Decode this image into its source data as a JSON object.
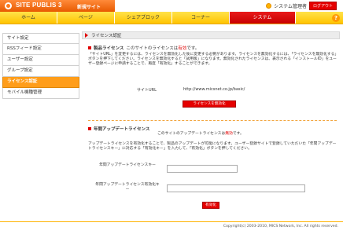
{
  "header": {
    "logo_text": "SITE PUBLIS 3",
    "site_name": "新規サイト",
    "user_label": "システム管理者",
    "logout_label": "ログアウト"
  },
  "nav": {
    "tabs": [
      {
        "label": "ホーム"
      },
      {
        "label": "ページ"
      },
      {
        "label": "シェアブロック"
      },
      {
        "label": "コーナー"
      },
      {
        "label": "システム"
      }
    ],
    "help_label": "?"
  },
  "sidebar": {
    "items": [
      {
        "label": "サイト設定"
      },
      {
        "label": "RSSフィード設定"
      },
      {
        "label": "ユーザー設定"
      },
      {
        "label": "グループ設定"
      },
      {
        "label": "ライセンス認証"
      },
      {
        "label": "モバイル機種管理"
      }
    ]
  },
  "main": {
    "title": "ライセンス認証",
    "product": {
      "heading": "製品ライセンス",
      "status_prefix": "このサイトのライセンスは",
      "status_value": "有効",
      "status_suffix": "です。",
      "description": "「サイトURL」を変更するには、ライセンスを無効化した後に変更する必要があります。ライセンスを無効化するには、「ライセンスを無効化する」ボタンを押下してください。ライセンスを無効化すると「試用版」になります。無効化されたライセンスは、表示される「インストールID」をユーザー登録ページに申請することで、再度「有効化」することができます。",
      "url_label": "サイトURL",
      "url_value": "http://www.micsnet.co.jp/basic/",
      "deactivate_label": "ライセンスを無効化"
    },
    "update": {
      "heading": "年間アップデートライセンス",
      "status_prefix": "このサイトのアップデートライセンスは",
      "status_value": "無効",
      "status_suffix": "です。",
      "description": "アップデートライセンスを有効化することで、製品のアップデートが可能になります。ユーザー登録サイトで登録していただいた「年間アップデートライセンスキー」に対応する「有効化キー」を入力して、「有効化」ボタンを押してください。",
      "key_label": "年間アップデートライセンスキー",
      "activation_key_label": "年間アップデートライセンス有効化キー",
      "key_value": "",
      "activation_key_value": "",
      "activate_label": "有効化"
    }
  },
  "footer": {
    "copyright": "Copyright(c) 2003-2010, MICS Network, Inc. All rights reserved."
  },
  "colors": {
    "accent_orange": "#ff9d1a",
    "nav_yellow": "#ffc400",
    "active_red": "#e50000"
  }
}
